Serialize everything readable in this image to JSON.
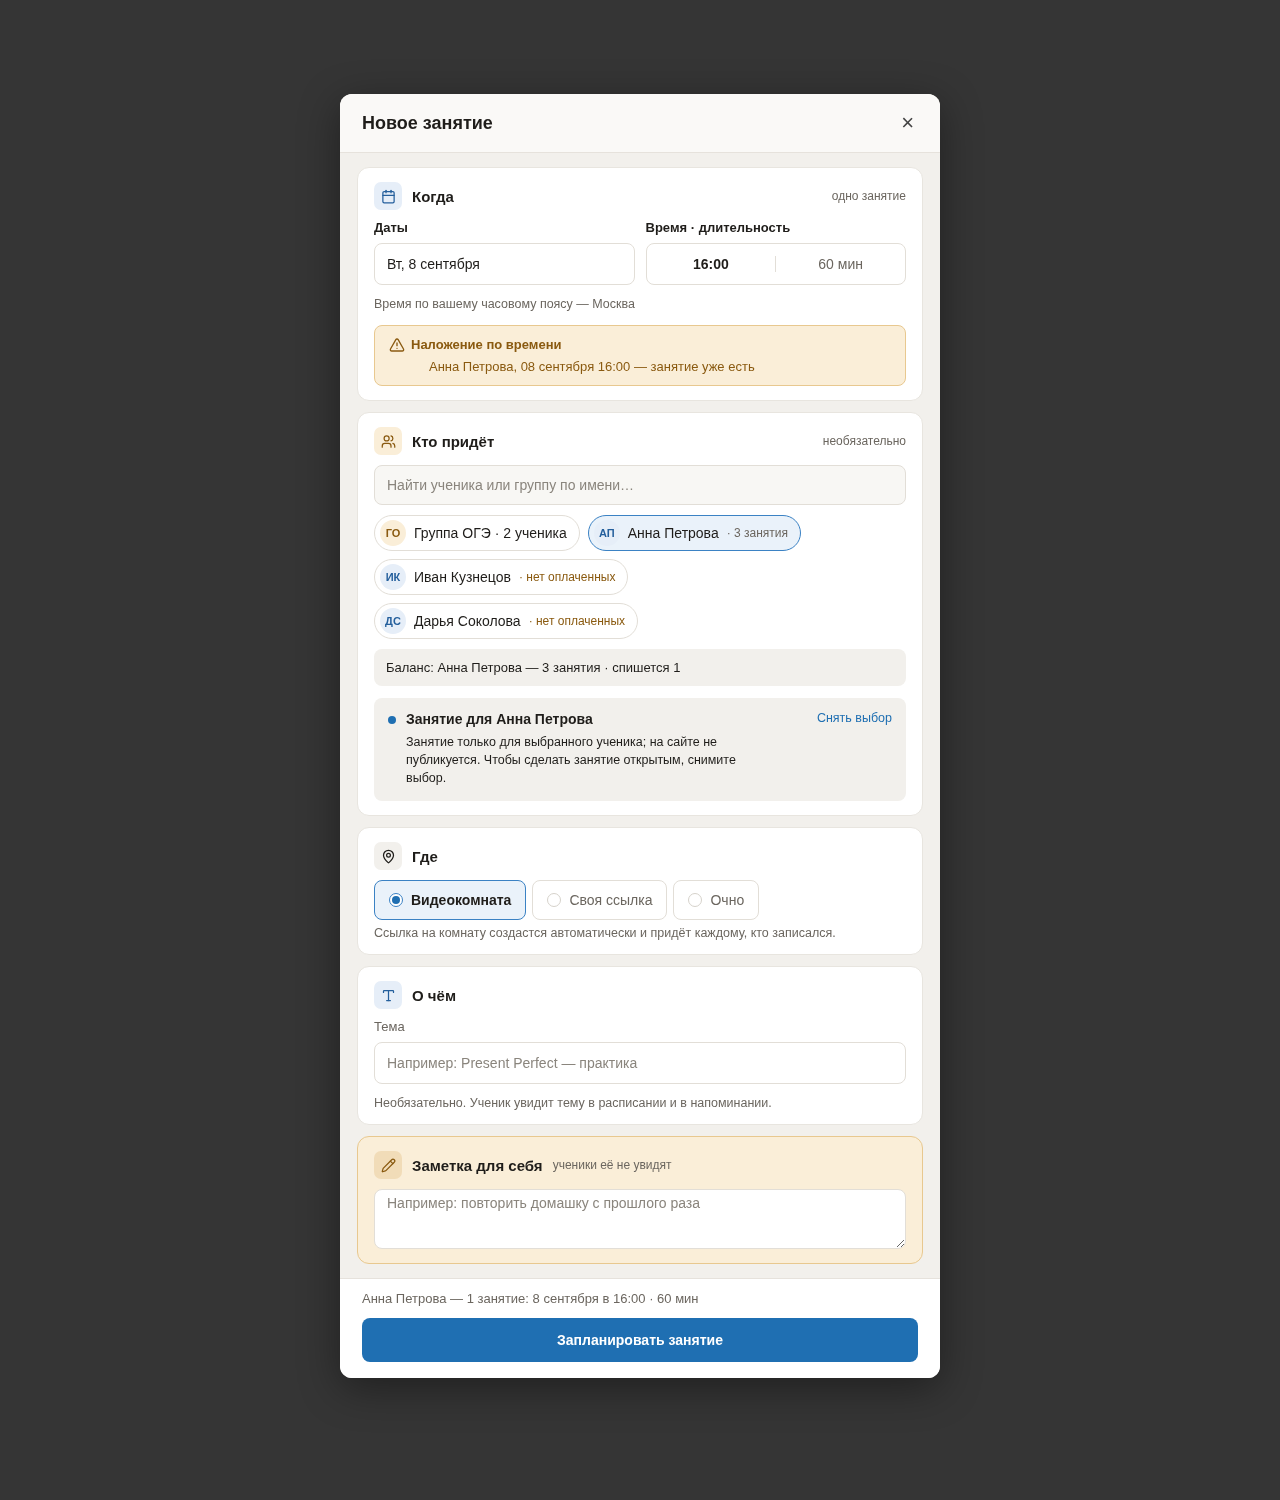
{
  "dialog": {
    "title": "Новое занятие",
    "close": "×"
  },
  "when": {
    "title": "Когда",
    "badge": "одно занятие",
    "dates_label": "Даты",
    "date": "Вт, 8 сентября",
    "time_label": "Время · длительность",
    "time": "16:00",
    "duration": "60 мин",
    "hint": "Время по вашему часовому поясу — Москва",
    "warning": {
      "title": "Наложение по времени",
      "text": "Анна Петрова, 08 сентября 16:00 — занятие уже есть"
    }
  },
  "who": {
    "title": "Кто придёт",
    "badge": "необязательно",
    "search_placeholder": "Найти ученика или группу по имени…",
    "chips": [
      {
        "kind": "group",
        "initials": "ГО",
        "name": "Группа ОГЭ · 2 ученика",
        "selected": false
      },
      {
        "kind": "student",
        "initials": "АП",
        "name": "Анна Петрова",
        "meta": "· 3 занятия",
        "warning": false,
        "selected": true
      },
      {
        "kind": "student",
        "initials": "ИК",
        "name": "Иван Кузнецов",
        "meta": "· нет оплаченных",
        "warning": true,
        "selected": false
      },
      {
        "kind": "student",
        "initials": "ДС",
        "name": "Дарья Соколова",
        "meta": "· нет оплаченных",
        "warning": true,
        "selected": false
      }
    ],
    "balance": "Баланс: Анна Петрова — 3 занятия · спишется 1",
    "notice": {
      "title": "Занятие для Анна Петрова",
      "text": "Занятие только для выбранного ученика; на сайте не публикуется. Чтобы сделать занятие открытым, снимите выбор.",
      "action": "Снять выбор"
    }
  },
  "where": {
    "title": "Где",
    "options": [
      {
        "label": "Видеокомната",
        "selected": true
      },
      {
        "label": "Своя ссылка",
        "selected": false
      },
      {
        "label": "Очно",
        "selected": false
      }
    ],
    "hint": "Ссылка на комнату создастся автоматически и придёт каждому, кто записался."
  },
  "about": {
    "title": "О чём",
    "topic_label": "Тема",
    "topic_placeholder": "Например: Present Perfect — практика",
    "hint": "Необязательно. Ученик увидит тему в расписании и в напоминании."
  },
  "note": {
    "title": "Заметка для себя",
    "subtitle": "ученики её не увидят",
    "placeholder": "Например: повторить домашку с прошлого раза"
  },
  "footer": {
    "summary": "Анна Петрова — 1 занятие: 8 сентября в 16:00 · 60 мин",
    "submit": "Запланировать занятие"
  }
}
